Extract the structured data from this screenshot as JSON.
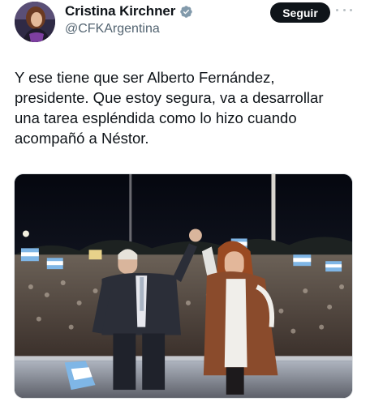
{
  "author": {
    "display_name": "Cristina Kirchner",
    "handle": "@CFKArgentina",
    "verified": true,
    "avatar_icon": "profile-photo"
  },
  "actions": {
    "follow_label": "Seguir",
    "more_icon": "more-dots-icon"
  },
  "tweet": {
    "lines": [
      "Y ese tiene que ser Alberto Fernández,",
      "presidente. Que estoy segura, va a desarrollar",
      "una tarea espléndida como lo hizo cuando",
      "acompañó a Néstor."
    ]
  },
  "media": {
    "kind": "photo",
    "description_icon": "rally-stage-photo"
  },
  "colors": {
    "text": "#0f1419",
    "secondary": "#536471",
    "verified": "#829aab",
    "button_bg": "#0f1419",
    "button_text": "#ffffff"
  }
}
